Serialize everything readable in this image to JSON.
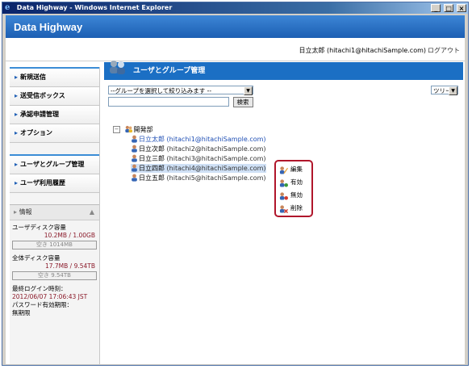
{
  "window": {
    "title": "Data Highway - Windows Internet Explorer",
    "ie_icon": "e",
    "minimize_icon": "_",
    "maximize_icon": "□",
    "close_icon": "×"
  },
  "header": {
    "brand": "Data Highway",
    "user": "日立太郎 (hitachi1@hitachiSample.com)",
    "logout": "ログアウト"
  },
  "sidebar": {
    "items": [
      {
        "label": "新規送信"
      },
      {
        "label": "送受信ボックス"
      },
      {
        "label": "承認申請管理"
      },
      {
        "label": "オプション"
      },
      {
        "label": "ユーザとグループ管理"
      },
      {
        "label": "ユーザ利用履歴"
      }
    ],
    "arrow": "▸",
    "info": {
      "title": "情報",
      "collapse_icon": "▲",
      "user_disk_label": "ユーザディスク容量",
      "user_disk_value": "10.2MB / 1.00GB",
      "user_disk_free": "空き 1014MB",
      "user_disk_used_fraction": 0.01,
      "all_disk_label": "全体ディスク容量",
      "all_disk_value": "17.7MB / 9.54TB",
      "all_disk_free": "空き 9.54TB",
      "all_disk_used_fraction": 0.0,
      "last_login_label": "最終ログイン時刻：",
      "last_login_value": "2012/06/07 17:06:43 JST",
      "pw_label": "パスワード有効期限：",
      "pw_value": "無期限"
    }
  },
  "main": {
    "title": "ユーザとグループ管理",
    "group_select": "--グループを選択して絞り込みます --",
    "view_select": "ツリー",
    "search_button": "検索",
    "tree": {
      "root": "開発部",
      "expander": "−",
      "users": [
        {
          "name": "日立太郎",
          "email": "(hitachi1@hitachiSample.com)",
          "highlight": true
        },
        {
          "name": "日立次郎",
          "email": "(hitachi2@hitachiSample.com)",
          "highlight": false
        },
        {
          "name": "日立三郎",
          "email": "(hitachi3@hitachiSample.com)",
          "highlight": false
        },
        {
          "name": "日立四郎",
          "email": "(hitachi4@hitachiSample.com)",
          "highlight": false,
          "selected": true
        },
        {
          "name": "日立五郎",
          "email": "(hitachi5@hitachiSample.com)",
          "highlight": false
        }
      ]
    },
    "context_menu": [
      {
        "label": "編集",
        "icon": "edit-icon"
      },
      {
        "label": "有効",
        "icon": "enable-icon"
      },
      {
        "label": "無効",
        "icon": "disable-icon"
      },
      {
        "label": "削除",
        "icon": "delete-icon"
      }
    ]
  },
  "colors": {
    "accent": "#1b6fc4",
    "context_border": "#b0162b",
    "email_link": "#1f4fb5",
    "disk_value": "#8b1a2a"
  }
}
